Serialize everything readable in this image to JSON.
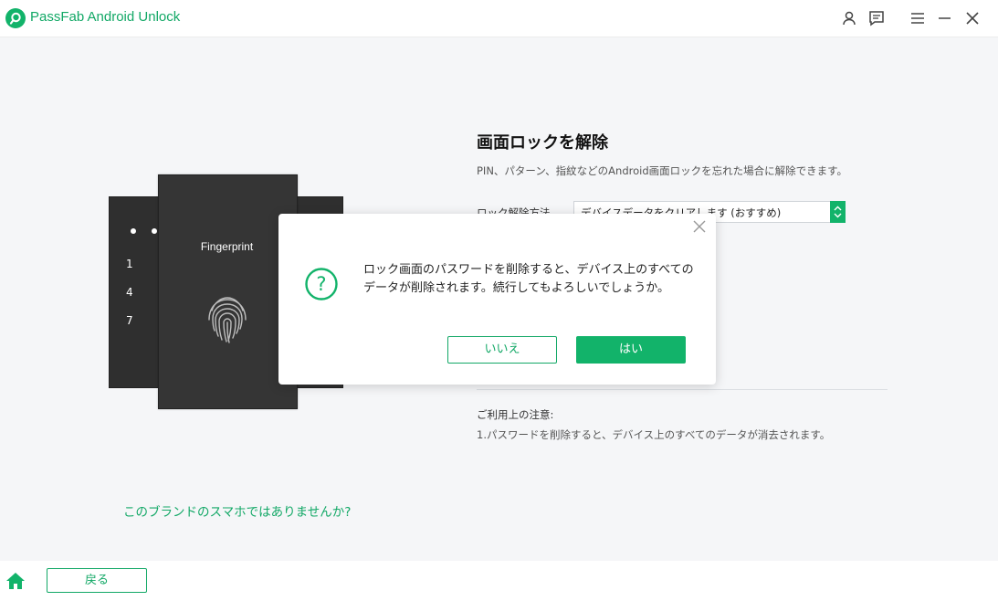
{
  "app": {
    "title": "PassFab Android Unlock",
    "accent": "#12b36a"
  },
  "titlebar_icons": [
    "user-icon",
    "feedback-icon",
    "menu-icon",
    "minimize-icon",
    "close-icon"
  ],
  "illustration": {
    "label": "Fingerprint",
    "keypad_numbers": [
      "1",
      "4",
      "7"
    ]
  },
  "main": {
    "title": "画面ロックを解除",
    "description": "PIN、パターン、指紋などのAndroid画面ロックを忘れた場合に解除できます。",
    "method_label": "ロック解除方法",
    "method_value": "デバイスデータをクリアします (おすすめ)"
  },
  "notes": {
    "title": "ご利用上の注意:",
    "item": "1.パスワードを削除すると、デバイス上のすべてのデータが消去されます。"
  },
  "brand_link": "このブランドのスマホではありませんか?",
  "dialog": {
    "message": "ロック画面のパスワードを削除すると、デバイス上のすべてのデータが削除されます。続行してもよろしいでしょうか。",
    "no_label": "いいえ",
    "yes_label": "はい"
  },
  "footer": {
    "back_label": "戻る"
  }
}
